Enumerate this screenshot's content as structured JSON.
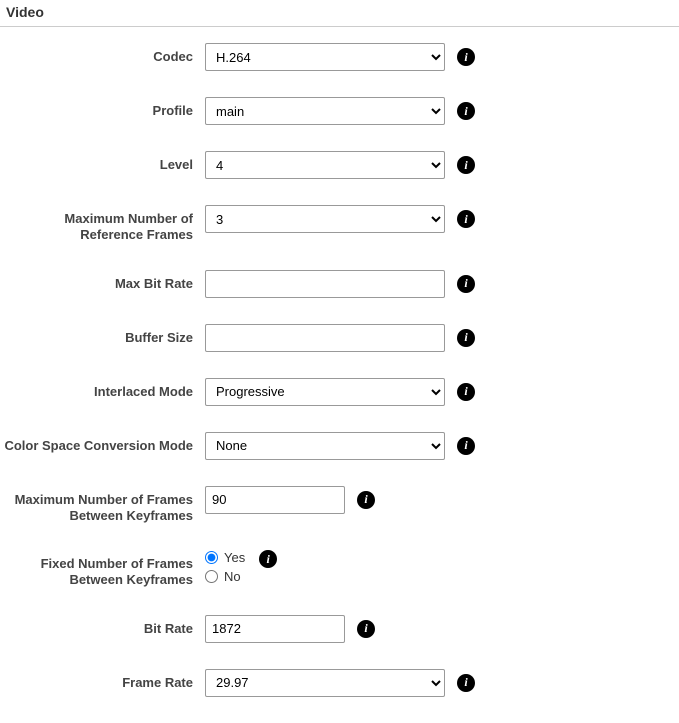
{
  "section": {
    "title": "Video"
  },
  "fields": {
    "codec": {
      "label": "Codec",
      "value": "H.264"
    },
    "profile": {
      "label": "Profile",
      "value": "main"
    },
    "level": {
      "label": "Level",
      "value": "4"
    },
    "maxRefFrames": {
      "label": "Maximum Number of Reference Frames",
      "value": "3"
    },
    "maxBitRate": {
      "label": "Max Bit Rate",
      "value": ""
    },
    "bufferSize": {
      "label": "Buffer Size",
      "value": ""
    },
    "interlacedMode": {
      "label": "Interlaced Mode",
      "value": "Progressive"
    },
    "colorSpace": {
      "label": "Color Space Conversion Mode",
      "value": "None"
    },
    "maxFramesBetweenKeyframes": {
      "label": "Maximum Number of Frames Between Keyframes",
      "value": "90"
    },
    "fixedFramesBetweenKeyframes": {
      "label": "Fixed Number of Frames Between Keyframes",
      "yesLabel": "Yes",
      "noLabel": "No",
      "selected": "Yes"
    },
    "bitRate": {
      "label": "Bit Rate",
      "value": "1872"
    },
    "frameRate": {
      "label": "Frame Rate",
      "value": "29.97"
    }
  }
}
